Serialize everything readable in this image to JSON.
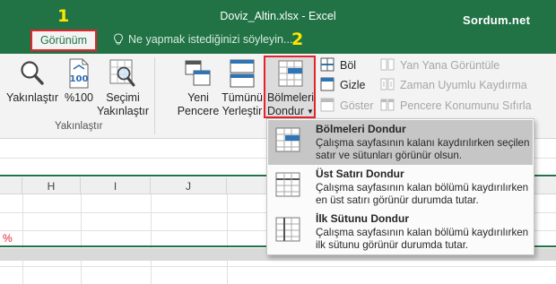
{
  "titlebar": {
    "title": "Doviz_Altin.xlsx  -  Excel",
    "step1": "1",
    "step2": "2",
    "watermark": "Sordum.net",
    "active_tab": "Görünüm",
    "tell_me": "Ne yapmak istediğinizi söyleyin..."
  },
  "ribbon": {
    "zoom_group": {
      "zoom_label": "Yakınlaştır",
      "zoom100_label": "%100",
      "zoom_selection_line1": "Seçimi",
      "zoom_selection_line2": "Yakınlaştır",
      "group_label": "Yakınlaştır"
    },
    "window_group": {
      "new_window_line1": "Yeni",
      "new_window_line2": "Pencere",
      "arrange_all_line1": "Tümünü",
      "arrange_all_line2": "Yerleştir",
      "freeze_panes_line1": "Bölmeleri",
      "freeze_panes_line2": "Dondur",
      "split_label": "Böl",
      "hide_label": "Gizle",
      "unhide_label": "Göster",
      "side_by_side_label": "Yan Yana Görüntüle",
      "sync_scroll_label": "Zaman Uyumlu Kaydırma",
      "reset_position_label": "Pencere Konumunu Sıfırla"
    }
  },
  "grid": {
    "columns": [
      "H",
      "I",
      "J"
    ],
    "cell_text": "%"
  },
  "dropdown": {
    "items": [
      {
        "title": "Bölmeleri Dondur",
        "description": "Çalışma sayfasının kalanı kaydırılırken seçilen satır ve sütunları görünür olsun."
      },
      {
        "title": "Üst Satırı Dondur",
        "description": "Çalışma sayfasının kalan bölümü kaydırılırken en üst satırı görünür durumda tutar."
      },
      {
        "title": "İlk Sütunu Dondur",
        "description": "Çalışma sayfasının kalan bölümü kaydırılırken ilk sütunu görünür durumda tutar."
      }
    ]
  },
  "colors": {
    "excel_green": "#217346",
    "highlight_red": "#e4232b",
    "step_number_yellow": "#ffe600"
  }
}
